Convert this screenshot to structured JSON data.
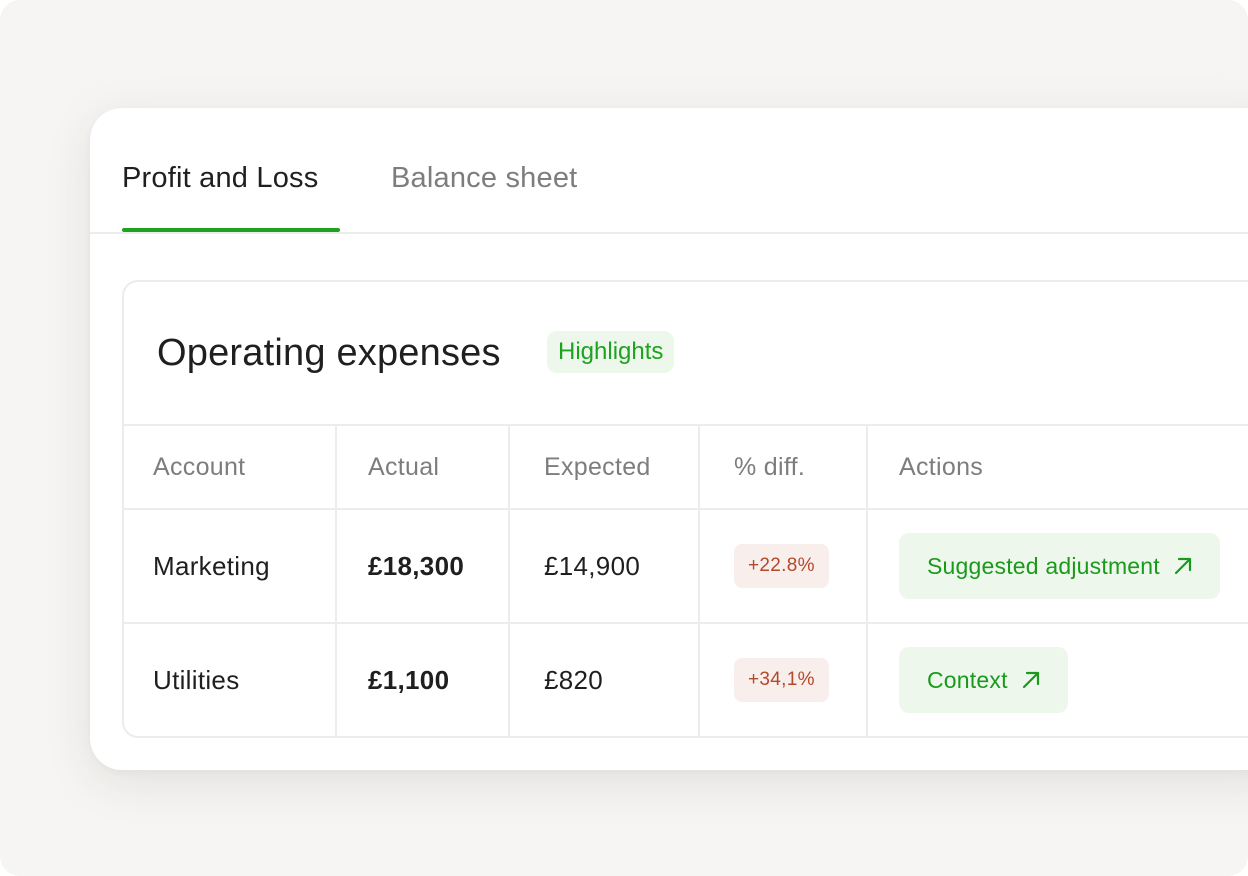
{
  "tabs": [
    {
      "label": "Profit and Loss",
      "active": true
    },
    {
      "label": "Balance sheet",
      "active": false
    }
  ],
  "panel": {
    "title": "Operating expenses",
    "badge": "Highlights"
  },
  "table": {
    "columns": [
      "Account",
      "Actual",
      "Expected",
      "% diff.",
      "Actions"
    ],
    "rows": [
      {
        "account": "Marketing",
        "actual": "£18,300",
        "expected": "£14,900",
        "diff": "+22.8%",
        "action": "Suggested adjustment"
      },
      {
        "account": "Utilities",
        "actual": "£1,100",
        "expected": "£820",
        "diff": "+34,1%",
        "action": "Context"
      }
    ]
  },
  "colors": {
    "accent": "#1ea320",
    "accent_bg": "#eef7ec",
    "negative": "#b4482a",
    "negative_bg": "#f8efec"
  },
  "icons": {
    "action_arrow": "arrow-up-right-icon"
  }
}
